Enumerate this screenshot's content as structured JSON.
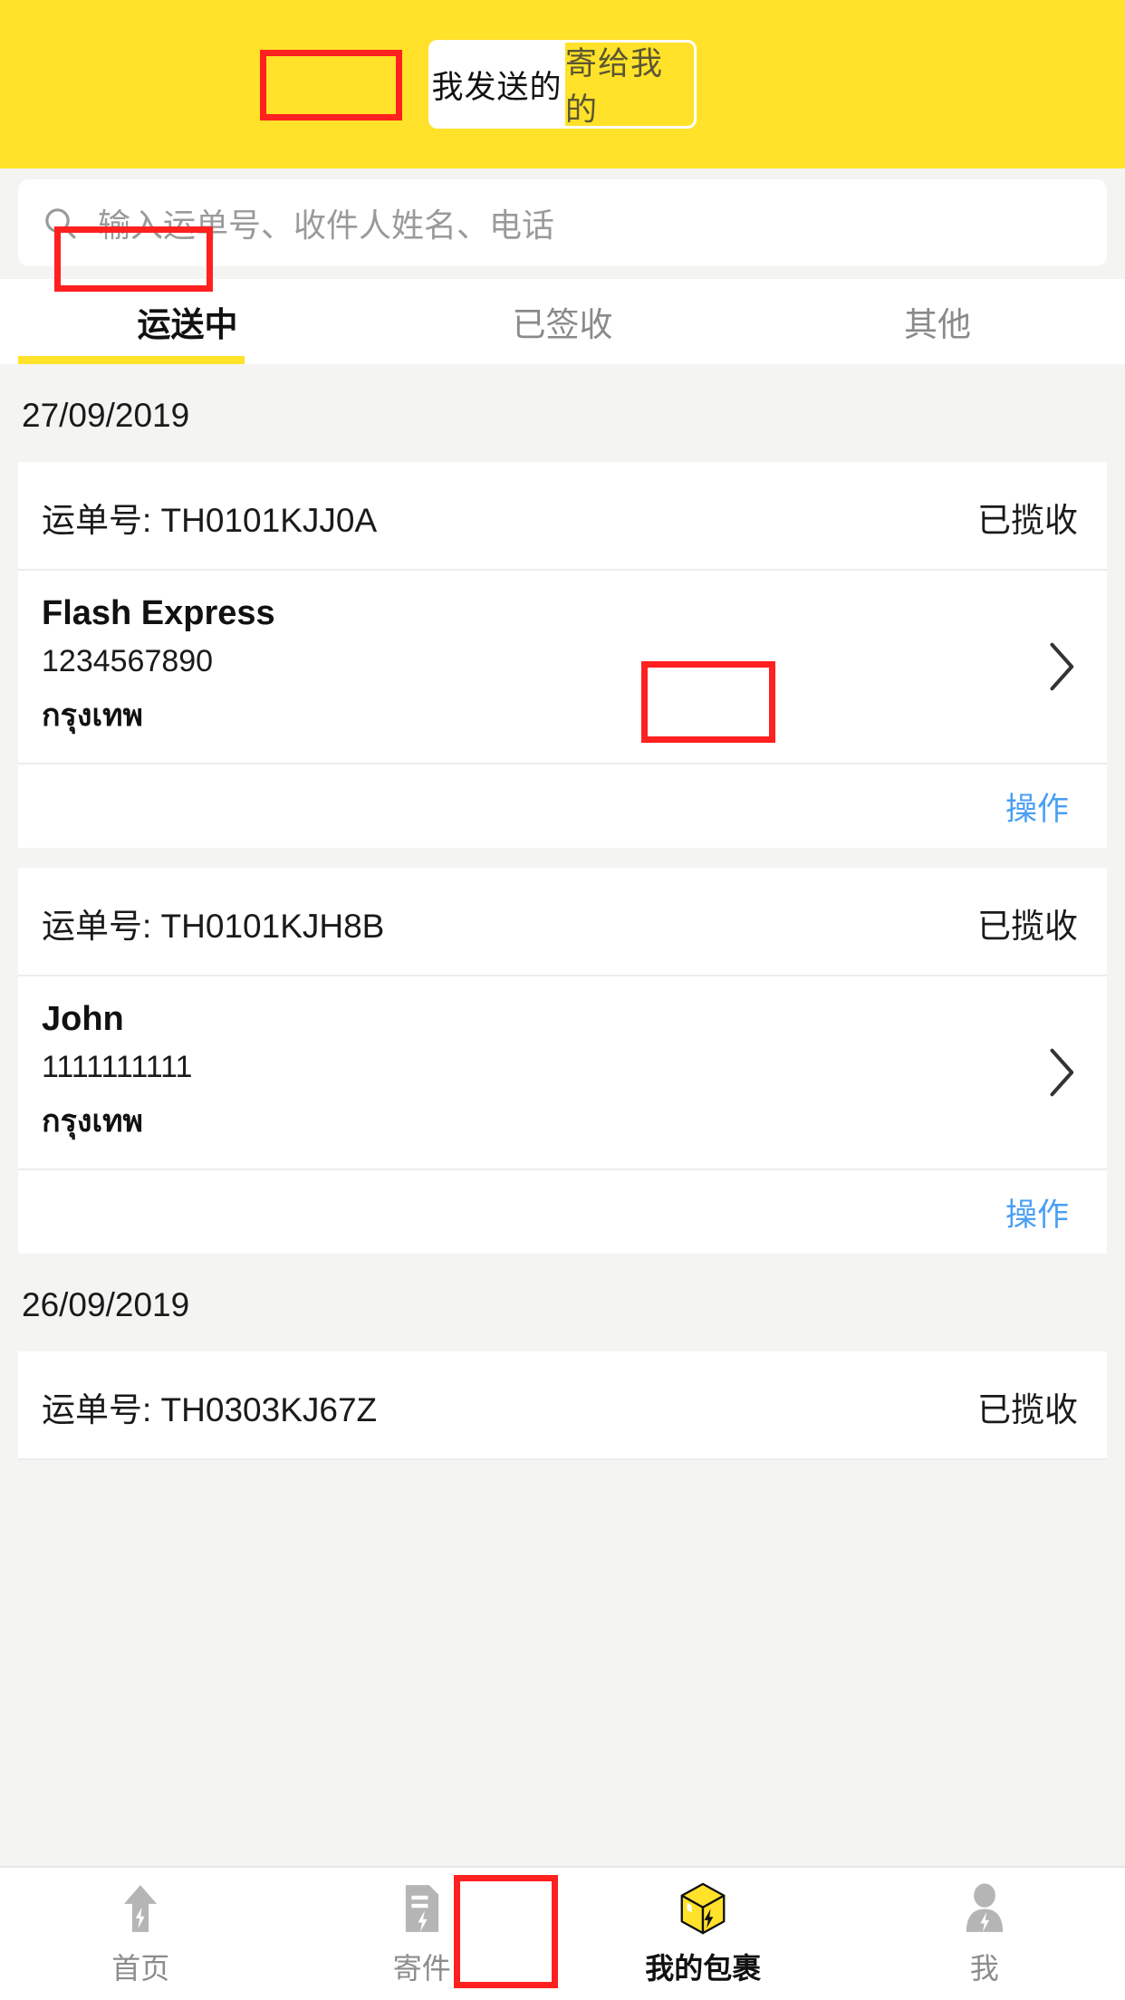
{
  "header": {
    "segmented": [
      {
        "label": "我发送的",
        "active": true
      },
      {
        "label": "寄给我的",
        "active": false
      }
    ]
  },
  "search": {
    "icon": "search-icon",
    "placeholder": "输入运单号、收件人姓名、电话",
    "value": ""
  },
  "tabs": [
    {
      "label": "运送中",
      "active": true
    },
    {
      "label": "已签收",
      "active": false
    },
    {
      "label": "其他",
      "active": false
    }
  ],
  "labels": {
    "waybill_prefix": "运单号:",
    "action": "操作",
    "chevron": "chevron-right-icon"
  },
  "groups": [
    {
      "date": "27/09/2019",
      "cards": [
        {
          "waybill": "运单号: TH0101KJJ0A",
          "status": "已揽收",
          "name": "Flash Express",
          "phone": "1234567890",
          "address": "กรุงเทพ",
          "action": "操作"
        },
        {
          "waybill": "运单号: TH0101KJH8B",
          "status": "已揽收",
          "name": "John",
          "phone": "1111111111",
          "address": "กรุงเทพ",
          "action": "操作"
        }
      ]
    },
    {
      "date": "26/09/2019",
      "cards": [
        {
          "waybill": "运单号: TH0303KJ67Z",
          "status": "已揽收",
          "name": "",
          "phone": "",
          "address": "",
          "action": ""
        }
      ]
    }
  ],
  "bottom_nav": [
    {
      "label": "首页",
      "icon": "home-arrow-icon",
      "active": false
    },
    {
      "label": "寄件",
      "icon": "document-pen-icon",
      "active": false
    },
    {
      "label": "我的包裹",
      "icon": "parcel-box-icon",
      "active": true
    },
    {
      "label": "我",
      "icon": "person-icon",
      "active": false
    }
  ],
  "colors": {
    "brand_yellow": "#ffe229",
    "page_bg": "#f4f4f2",
    "card_bg": "#ffffff",
    "link_blue": "#4a9ff5",
    "annotation_red": "#ff2020",
    "muted_gray": "#8a8a8a"
  }
}
